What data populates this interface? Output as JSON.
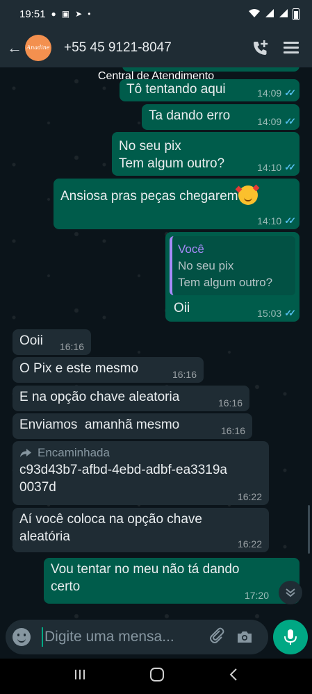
{
  "status_bar": {
    "time": "19:51"
  },
  "header": {
    "avatar_text": "Anadine",
    "contact_name": "+55 45 9121-8047"
  },
  "chat": {
    "top_label": "Central de Atendimento",
    "messages": [
      {
        "text": "Tô tentando aqui",
        "time": "14:09"
      },
      {
        "text": "Ta dando erro",
        "time": "14:09"
      },
      {
        "line1": "No seu pix",
        "line2": "Tem algum outro?",
        "time": "14:10"
      },
      {
        "text": "Ansiosa pras peças chegarem",
        "time": "14:10"
      },
      {
        "quote_author": "Você",
        "quote_line1": "No seu pix",
        "quote_line2": "Tem algum outro?",
        "text": "Oii",
        "time": "15:03"
      },
      {
        "text": "Ooii",
        "time": "16:16"
      },
      {
        "text": "O Pix e este mesmo",
        "time": "16:16"
      },
      {
        "text": "E na opção chave aleatoria",
        "time": "16:16"
      },
      {
        "text": "Enviamos  amanhã mesmo",
        "time": "16:16"
      },
      {
        "forwarded_label": "Encaminhada",
        "line1": "c93d43b7-afbd-4ebd-adbf-ea3319a",
        "line2": "0037d",
        "time": "16:22"
      },
      {
        "line1": "Aí você coloca na opção chave",
        "line2": "aleatória",
        "time": "16:22"
      },
      {
        "line1": "Vou tentar no meu não tá dando",
        "line2": "certo",
        "time": "17:20"
      }
    ]
  },
  "input": {
    "placeholder": "Digite uma mensa..."
  },
  "colors": {
    "outgoing_bubble": "#005c4b",
    "incoming_bubble": "#1f2c34",
    "read_ticks": "#53bdeb",
    "accent": "#00a884",
    "header": "#1f2c34"
  }
}
